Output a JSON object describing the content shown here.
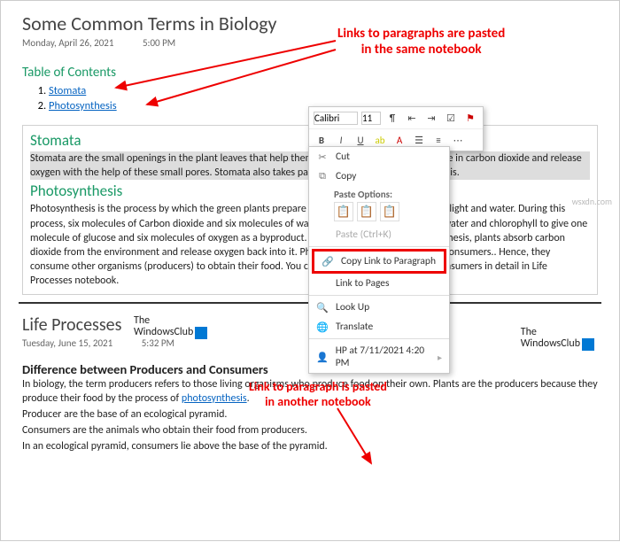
{
  "ann1": "Links to paragraphs are pasted\nin the same notebook",
  "ann2": "Link to paragraph is pasted\nin another notebook",
  "logo_text": "The\nWindowsClub",
  "watermark": "wsxdn.com",
  "page1": {
    "title": "Some Common Terms in Biology",
    "date": "Monday, April 26, 2021",
    "time": "5:00 PM",
    "toc_head": "Table of Contents",
    "toc": [
      "Stomata",
      "Photosynthesis"
    ],
    "h_stomata": "Stomata",
    "p_stomata": "Stomata are the small openings in the plant leaves that help them exchange gases. The plants take in carbon dioxide and release oxygen with the help of these small pores. Stomata also takes part in the process of photosynthesis.",
    "h_photo": "Photosynthesis",
    "p_photo": "Photosynthesis is the process by which the green plants prepare their food in the presence of sunlight and water. During this process, six molecules of Carbon dioxide and six molecules of water combine in the presence of water and chlorophyll to give one molecule of glucose and six molecules of oxygen as a byproduct. During the process of photosynthesis, plants absorb carbon dioxide from the environment and release oxygen back into it.\nPhotosynthesis does not occur in consumers.. Hence, they consume other organisms (producers) to obtain their food. You can read about producers and consumers in detail in Life Processes notebook."
  },
  "page2": {
    "title": "Life Processes",
    "date": "Tuesday, June 15, 2021",
    "time": "5:32 PM",
    "h_diff": "Difference between Producers and Consumers",
    "p1a": "In biology, the term producers refers to those living organisms who produce food on their own. Plants are the producers because they produce their food by the process of ",
    "p1link": "photosynthesis",
    "p1b": ".",
    "p2": "Producer are the base of an ecological pyramid.",
    "p3": "Consumers are the animals who obtain their food from producers.",
    "p4": "In an ecological pyramid, consumers lie above the base of the pyramid."
  },
  "toolbar": {
    "font": "Calibri",
    "size": "11"
  },
  "menu": {
    "cut": "Cut",
    "copy": "Copy",
    "paste_opt": "Paste Options:",
    "paste_hint": "Paste (Ctrl+K)",
    "copylink": "Copy Link to Paragraph",
    "linkpages": "Link to Pages",
    "lookup": "Look Up",
    "translate": "Translate",
    "hp": "HP at 7/11/2021 4:20 PM"
  }
}
